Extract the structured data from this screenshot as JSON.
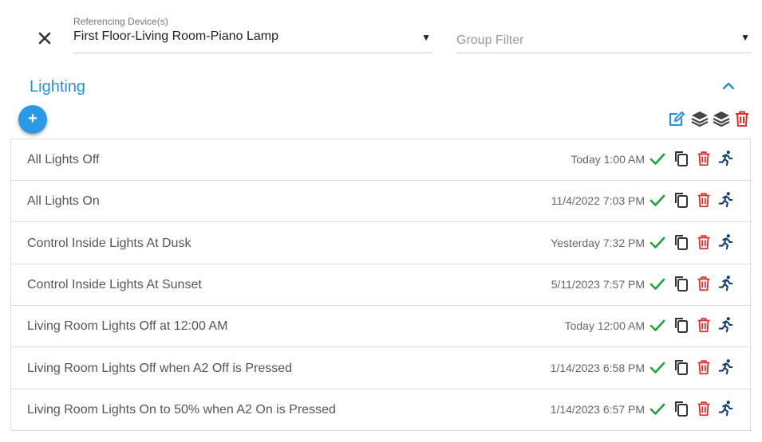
{
  "device_field": {
    "label": "Referencing Device(s)",
    "value": "First Floor-Living Room-Piano Lamp",
    "arrow": "▼"
  },
  "group_filter": {
    "placeholder": "Group Filter",
    "arrow": "▼"
  },
  "section": {
    "title": "Lighting",
    "add_button": "+"
  },
  "icons": {
    "close": "close-icon",
    "collapse": "chevron-up-icon",
    "toolbar": [
      "edit-icon",
      "layers-icon",
      "layers-icon",
      "trash-icon"
    ],
    "row": [
      "check-icon",
      "copy-icon",
      "trash-icon",
      "run-icon"
    ]
  },
  "colors": {
    "accent": "#2a8fd6",
    "fab": "#2a9ae6",
    "check": "#1fa33a",
    "trash": "#d93030",
    "run": "#123f73"
  },
  "rows": [
    {
      "name": "All Lights Off",
      "time": "Today 1:00 AM"
    },
    {
      "name": "All Lights On",
      "time": "11/4/2022 7:03 PM"
    },
    {
      "name": "Control Inside Lights At Dusk",
      "time": "Yesterday 7:32 PM"
    },
    {
      "name": "Control Inside Lights At Sunset",
      "time": "5/11/2023 7:57 PM"
    },
    {
      "name": "Living Room Lights Off at 12:00 AM",
      "time": "Today 12:00 AM"
    },
    {
      "name": "Living Room Lights Off when A2 Off is Pressed",
      "time": "1/14/2023 6:58 PM"
    },
    {
      "name": "Living Room Lights On to 50% when A2 On is Pressed",
      "time": "1/14/2023 6:57 PM"
    }
  ]
}
